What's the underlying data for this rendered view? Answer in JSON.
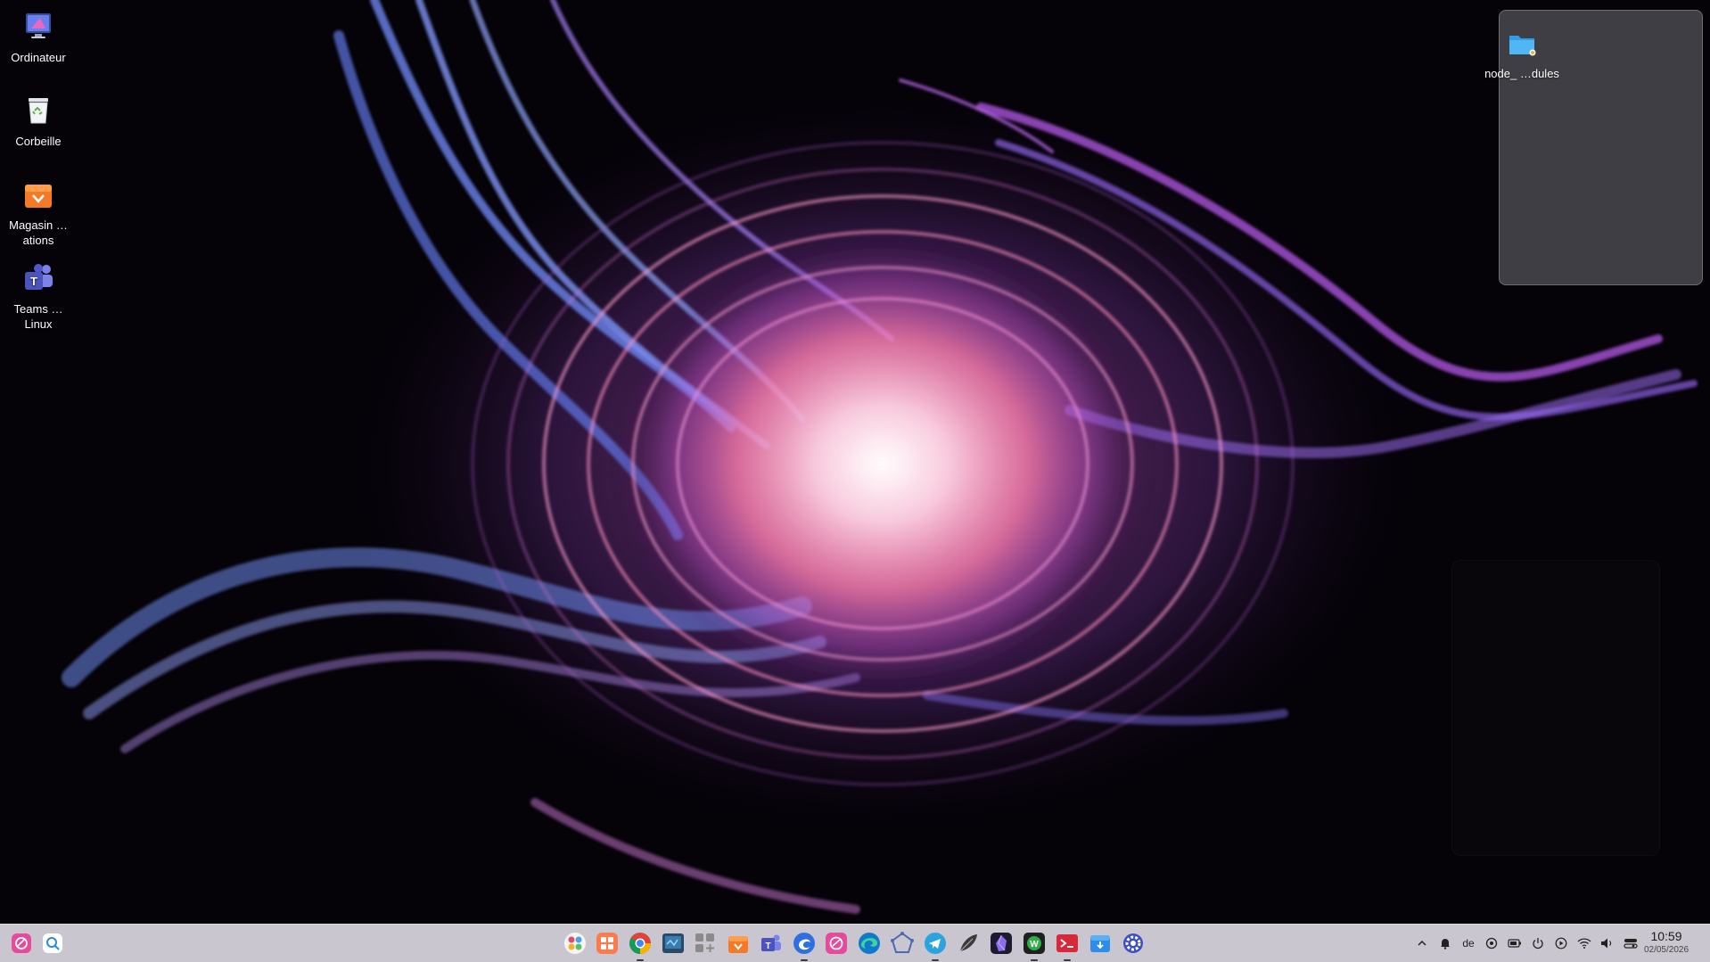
{
  "desktop": {
    "icons": [
      {
        "label": "Ordinateur",
        "icon": "computer-icon"
      },
      {
        "label": "Corbeille",
        "icon": "trash-icon"
      },
      {
        "label": "Magasin …ations",
        "icon": "app-store-icon"
      },
      {
        "label": "Teams … Linux",
        "icon": "teams-icon"
      }
    ],
    "folder": {
      "label": "node_ …dules",
      "icon": "folder-icon"
    }
  },
  "taskbar": {
    "left": [
      {
        "name": "launcher-icon"
      },
      {
        "name": "search-icon"
      }
    ],
    "apps": [
      {
        "name": "multitasking-view-icon"
      },
      {
        "name": "app-grid-icon"
      },
      {
        "name": "chrome-icon"
      },
      {
        "name": "terminal-monitor-icon"
      },
      {
        "name": "widgets-add-icon"
      },
      {
        "name": "app-store-icon"
      },
      {
        "name": "teams-icon"
      },
      {
        "name": "browser-blue-icon"
      },
      {
        "name": "deepin-icon"
      },
      {
        "name": "edge-icon"
      },
      {
        "name": "screenshot-pentagon-icon"
      },
      {
        "name": "telegram-icon"
      },
      {
        "name": "feather-icon"
      },
      {
        "name": "obsidian-icon"
      },
      {
        "name": "wps-icon"
      },
      {
        "name": "red-terminal-icon"
      },
      {
        "name": "package-installer-icon"
      },
      {
        "name": "settings-gear-icon"
      }
    ],
    "tray": {
      "keyboard_layout": "de",
      "time": "10:59",
      "date": "02/05/2026"
    }
  },
  "colors": {
    "taskbar_bg": "#c9c6cf",
    "accent": "#e64a9a"
  }
}
